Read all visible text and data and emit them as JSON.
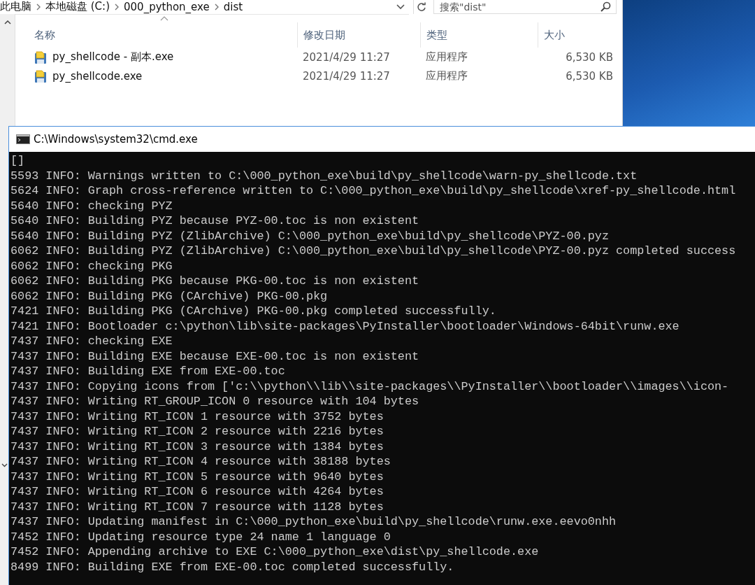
{
  "explorer": {
    "breadcrumb": [
      "此电脑",
      "本地磁盘 (C:)",
      "000_python_exe",
      "dist"
    ],
    "search": {
      "placeholder": "搜索\"dist\""
    },
    "columns": [
      "名称",
      "修改日期",
      "类型",
      "大小"
    ],
    "files": [
      {
        "name": "py_shellcode - 副本.exe",
        "date": "2021/4/29 11:27",
        "type": "应用程序",
        "size": "6,530 KB"
      },
      {
        "name": "py_shellcode.exe",
        "date": "2021/4/29 11:27",
        "type": "应用程序",
        "size": "6,530 KB"
      }
    ]
  },
  "console": {
    "title": "C:\\Windows\\system32\\cmd.exe",
    "lines": [
      "[]",
      "5593 INFO: Warnings written to C:\\000_python_exe\\build\\py_shellcode\\warn-py_shellcode.txt",
      "5624 INFO: Graph cross-reference written to C:\\000_python_exe\\build\\py_shellcode\\xref-py_shellcode.html",
      "5640 INFO: checking PYZ",
      "5640 INFO: Building PYZ because PYZ-00.toc is non existent",
      "5640 INFO: Building PYZ (ZlibArchive) C:\\000_python_exe\\build\\py_shellcode\\PYZ-00.pyz",
      "6062 INFO: Building PYZ (ZlibArchive) C:\\000_python_exe\\build\\py_shellcode\\PYZ-00.pyz completed success",
      "6062 INFO: checking PKG",
      "6062 INFO: Building PKG because PKG-00.toc is non existent",
      "6062 INFO: Building PKG (CArchive) PKG-00.pkg",
      "7421 INFO: Building PKG (CArchive) PKG-00.pkg completed successfully.",
      "7421 INFO: Bootloader c:\\python\\lib\\site-packages\\PyInstaller\\bootloader\\Windows-64bit\\runw.exe",
      "7437 INFO: checking EXE",
      "7437 INFO: Building EXE because EXE-00.toc is non existent",
      "7437 INFO: Building EXE from EXE-00.toc",
      "7437 INFO: Copying icons from ['c:\\\\python\\\\lib\\\\site-packages\\\\PyInstaller\\\\bootloader\\\\images\\\\icon-",
      "7437 INFO: Writing RT_GROUP_ICON 0 resource with 104 bytes",
      "7437 INFO: Writing RT_ICON 1 resource with 3752 bytes",
      "7437 INFO: Writing RT_ICON 2 resource with 2216 bytes",
      "7437 INFO: Writing RT_ICON 3 resource with 1384 bytes",
      "7437 INFO: Writing RT_ICON 4 resource with 38188 bytes",
      "7437 INFO: Writing RT_ICON 5 resource with 9640 bytes",
      "7437 INFO: Writing RT_ICON 6 resource with 4264 bytes",
      "7437 INFO: Writing RT_ICON 7 resource with 1128 bytes",
      "7437 INFO: Updating manifest in C:\\000_python_exe\\build\\py_shellcode\\runw.exe.eevo0nhh",
      "7452 INFO: Updating resource type 24 name 1 language 0",
      "7452 INFO: Appending archive to EXE C:\\000_python_exe\\dist\\py_shellcode.exe",
      "8499 INFO: Building EXE from EXE-00.toc completed successfully."
    ]
  }
}
